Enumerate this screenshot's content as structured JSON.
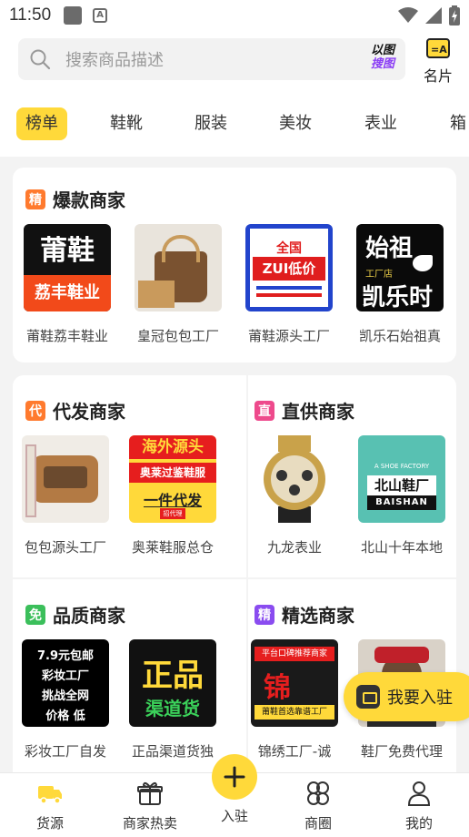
{
  "status_bar": {
    "time": "11:50"
  },
  "header": {
    "search_placeholder": "搜索商品描述",
    "image_search_line1": "以图",
    "image_search_line2": "搜图",
    "business_card_label": "名片"
  },
  "categories": [
    "榜单",
    "鞋靴",
    "服装",
    "美妆",
    "表业",
    "箱"
  ],
  "sections": {
    "hot": {
      "title": "爆款商家",
      "badge": "精",
      "shops": [
        {
          "name": "莆鞋荔丰鞋业",
          "img_top": "莆鞋",
          "img_bottom": "荔丰鞋业"
        },
        {
          "name": "皇冠包包工厂"
        },
        {
          "name": "莆鞋源头工厂",
          "img_text1": "全国",
          "img_text2": "ZUI低价"
        },
        {
          "name": "凯乐石始祖真",
          "img_text1": "始祖",
          "img_text2": "工厂店",
          "img_text3": "凯乐时"
        }
      ]
    },
    "dropship": {
      "title": "代发商家",
      "badge": "代",
      "shops": [
        {
          "name": "包包源头工厂"
        },
        {
          "name": "奥莱鞋服总仓",
          "img_text1": "海外源头",
          "img_text2": "奥莱过鉴鞋服",
          "img_text3": "一件代发",
          "img_text4": "招代理"
        }
      ]
    },
    "direct": {
      "title": "直供商家",
      "badge": "直",
      "shops": [
        {
          "name": "九龙表业"
        },
        {
          "name": "北山十年本地",
          "img_text1": "A SHOE FACTORY",
          "img_text2": "北山鞋厂",
          "img_text3": "BAISHAN"
        }
      ]
    },
    "quality": {
      "title": "品质商家",
      "badge": "免",
      "shops": [
        {
          "name": "彩妆工厂自发",
          "img_lines": [
            "7.9元包邮",
            "彩妆工厂",
            "挑战全网",
            "价格  低"
          ]
        },
        {
          "name": "正品渠道货独",
          "img_text1": "正品",
          "img_text2": "渠道货"
        }
      ]
    },
    "selected": {
      "title": "精选商家",
      "badge": "精",
      "shops": [
        {
          "name": "锦绣工厂-诚",
          "img_text1": "平台口碑推荐商家",
          "img_text2": "锦",
          "img_text3": "莆鞋首选靠谱工厂"
        },
        {
          "name": "鞋厂免费代理"
        }
      ]
    }
  },
  "float_button": {
    "label": "我要入驻"
  },
  "bottom_nav": {
    "items": [
      "货源",
      "商家热卖",
      "入驻",
      "商圈",
      "我的"
    ]
  },
  "colors": {
    "accent_yellow": "#ffd93a",
    "purple": "#8a3cf5",
    "badge_orange": "#ff7a2e",
    "badge_pink": "#ee4a8c",
    "badge_green": "#3bbf5b",
    "badge_violet": "#8a4cf0"
  }
}
